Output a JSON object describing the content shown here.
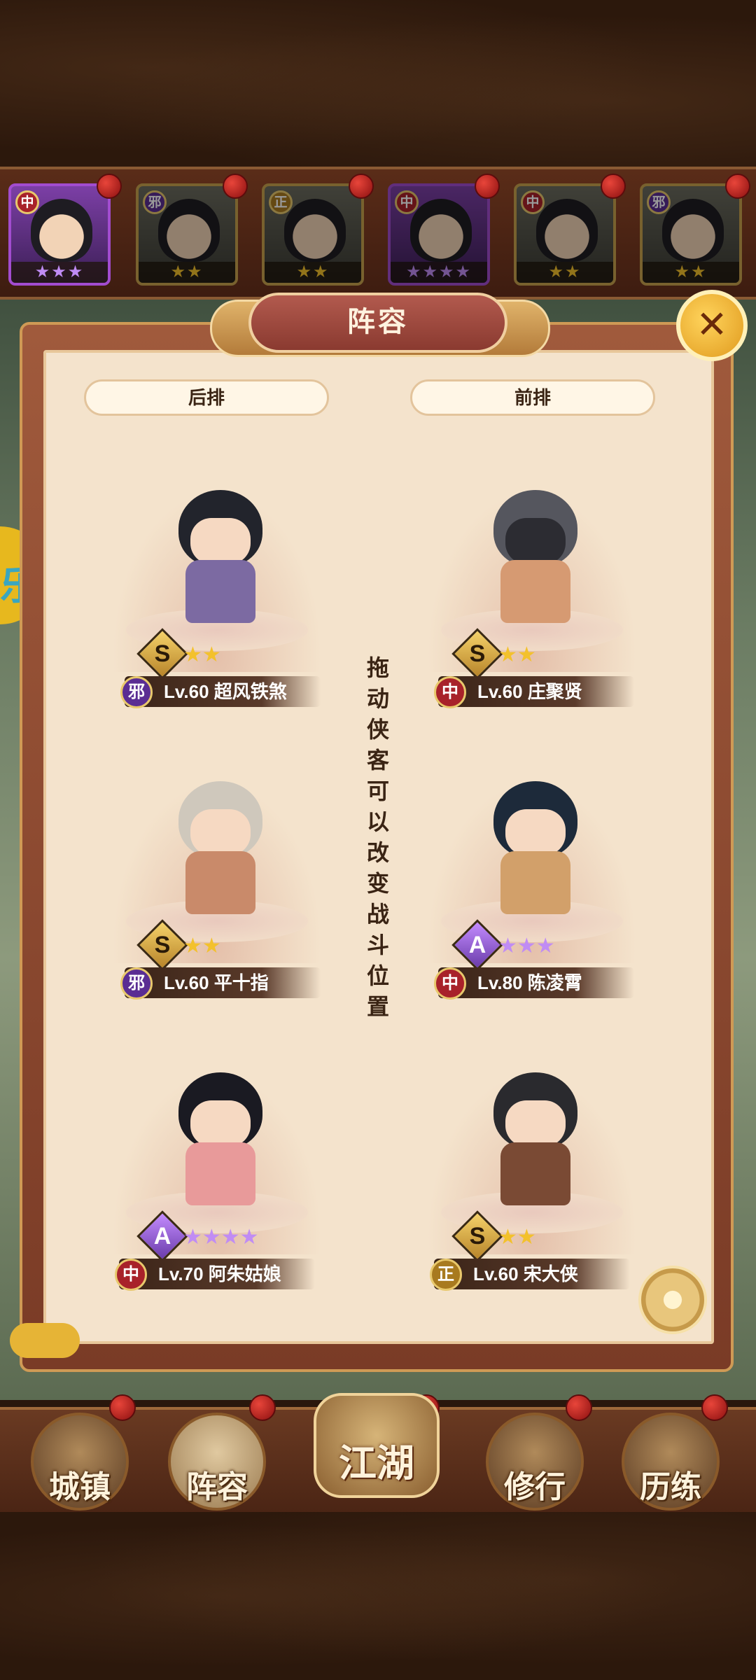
{
  "panel": {
    "title": "阵容",
    "close_icon": "close-icon",
    "back_row_label": "后排",
    "front_row_label": "前排",
    "hint": "拖动侠客可以改变战斗位置"
  },
  "roster": [
    {
      "faction": "中",
      "stars": "★★★",
      "star_color": "purple",
      "frame": "purple"
    },
    {
      "faction": "邪",
      "stars": "★★",
      "star_color": "gold",
      "frame": "gold"
    },
    {
      "faction": "正",
      "stars": "★★",
      "star_color": "gold",
      "frame": "gold"
    },
    {
      "faction": "中",
      "stars": "★★★★",
      "star_color": "purple",
      "frame": "purple"
    },
    {
      "faction": "中",
      "stars": "★★",
      "star_color": "gold",
      "frame": "gold"
    },
    {
      "faction": "邪",
      "stars": "★★",
      "star_color": "gold",
      "frame": "gold"
    }
  ],
  "heroes": [
    {
      "rank": "S",
      "stars": "★★",
      "faction": "邪",
      "name": "Lv.60 超风铁煞",
      "star_color": "gold"
    },
    {
      "rank": "S",
      "stars": "★★",
      "faction": "中",
      "name": "Lv.60 庄聚贤",
      "star_color": "gold"
    },
    {
      "rank": "S",
      "stars": "★★",
      "faction": "邪",
      "name": "Lv.60 平十指",
      "star_color": "gold"
    },
    {
      "rank": "A",
      "stars": "★★★",
      "faction": "中",
      "name": "Lv.80 陈凌霄",
      "star_color": "purple"
    },
    {
      "rank": "A",
      "stars": "★★★★",
      "faction": "中",
      "name": "Lv.70 阿朱姑娘",
      "star_color": "purple"
    },
    {
      "rank": "S",
      "stars": "★★",
      "faction": "正",
      "name": "Lv.60 宋大侠",
      "star_color": "gold"
    }
  ],
  "nav": {
    "town": "城镇",
    "lineup": "阵容",
    "jianghu": "江湖",
    "cultivate": "修行",
    "training": "历练"
  },
  "side_badge": "乐"
}
